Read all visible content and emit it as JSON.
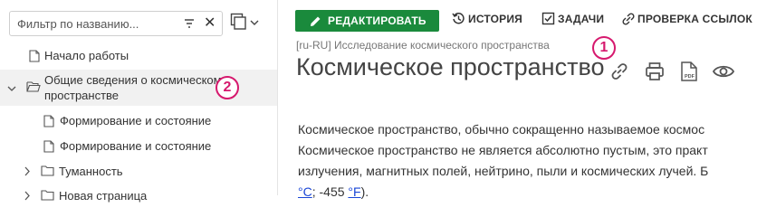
{
  "sidebar": {
    "filter_placeholder": "Фильтр по названию...",
    "items": [
      {
        "label": "Начало работы"
      },
      {
        "label_line1": "Общие сведения о космическом",
        "label_line2": "пространстве"
      },
      {
        "label": "Формирование и состояние"
      },
      {
        "label": "Формирование и состояние"
      },
      {
        "label": "Туманность"
      },
      {
        "label": "Новая страница"
      }
    ]
  },
  "toolbar": {
    "edit_label": "РЕДАКТИРОВАТЬ",
    "history_label": "ИСТОРИЯ",
    "tasks_label": "ЗАДАЧИ",
    "links_label": "ПРОВЕРКА ССЫЛОК"
  },
  "page": {
    "breadcrumb": "[ru-RU] Исследование космического пространства",
    "title": "Космическое пространство",
    "para_line1": "Космическое пространство, обычно сокращенно называемое космос",
    "para_line2": "Космическое пространство не является абсолютно пустым, это практ",
    "para_line3": "излучения, магнитных полей, нейтрино, пыли и космических лучей. Б",
    "para_line4_link1": "°C",
    "para_line4_mid": "; -455 ",
    "para_line4_link2": "°F",
    "para_line4_end": ")."
  },
  "badges": {
    "one": "1",
    "two": "2"
  },
  "colors": {
    "primary_green": "#1a8a3c",
    "badge": "#d6196e",
    "link": "#1a46d6"
  },
  "icons": [
    "funnel-icon",
    "close-icon",
    "copy-icon",
    "chevron-down-icon",
    "chevron-right-icon",
    "document-icon",
    "folder-open-icon",
    "folder-icon",
    "pencil-icon",
    "history-icon",
    "checkbox-icon",
    "link-check-icon",
    "link-icon",
    "printer-icon",
    "pdf-icon",
    "eye-icon"
  ]
}
